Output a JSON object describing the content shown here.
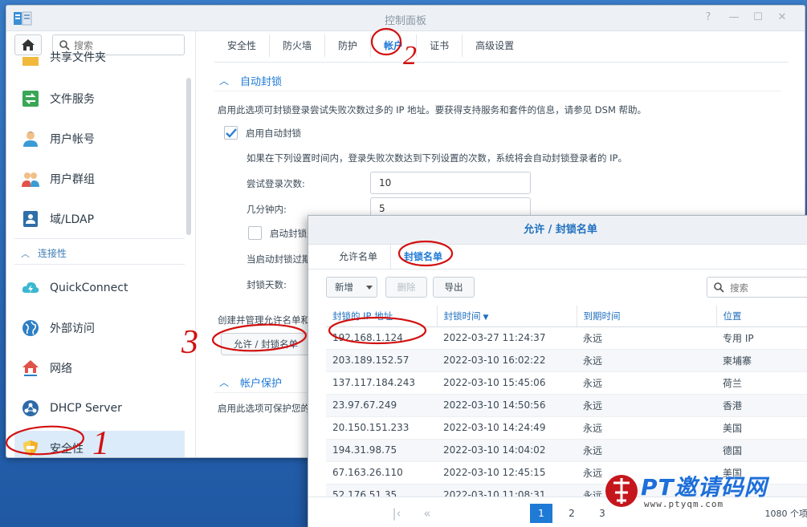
{
  "window": {
    "title": "控制面板"
  },
  "sidebar": {
    "search_placeholder": "搜索",
    "cut_item": "共享文件夹",
    "items": [
      {
        "label": "文件服务",
        "icon": "file-services-icon"
      },
      {
        "label": "用户帐号",
        "icon": "user-icon"
      },
      {
        "label": "用户群组",
        "icon": "group-icon"
      },
      {
        "label": "域/LDAP",
        "icon": "ldap-icon"
      }
    ],
    "section": "连接性",
    "conn_items": [
      {
        "label": "QuickConnect",
        "icon": "quickconnect-icon"
      },
      {
        "label": "外部访问",
        "icon": "external-access-icon"
      },
      {
        "label": "网络",
        "icon": "network-icon"
      },
      {
        "label": "DHCP Server",
        "icon": "dhcp-icon"
      },
      {
        "label": "安全性",
        "icon": "security-shield-icon"
      }
    ]
  },
  "tabs": [
    "安全性",
    "防火墙",
    "防护",
    "帐户",
    "证书",
    "高级设置"
  ],
  "autoblock": {
    "title": "自动封锁",
    "desc": "启用此选项可封锁登录尝试失败次数过多的 IP 地址。要获得支持服务和套件的信息，请参见 DSM 帮助。",
    "enable_label": "启用自动封锁",
    "hint": "如果在下列设置时间内，登录失败次数达到下列设置的次数，系统将会自动封锁登录者的 IP。",
    "attempts_label": "尝试登录次数:",
    "attempts_value": "10",
    "minutes_label": "几分钟内:",
    "minutes_value": "5",
    "expire_label": "启动封锁过",
    "expire_desc": "当启动封锁过期",
    "days_label": "封锁天数:",
    "manage_label": "创建并管理允许名单和",
    "allow_btn": "允许 / 封锁名单"
  },
  "account_protect": {
    "title": "帐户保护",
    "desc": "启用此选项可保护您的"
  },
  "dialog": {
    "title": "允许 / 封锁名单",
    "tabs": [
      "允许名单",
      "封锁名单"
    ],
    "btn_new": "新增",
    "btn_delete": "删除",
    "btn_export": "导出",
    "search_placeholder": "搜索",
    "columns": [
      "封锁的 IP 地址",
      "封锁时间",
      "到期时间",
      "位置"
    ],
    "rows": [
      [
        "192.168.1.124",
        "2022-03-27 11:24:37",
        "永远",
        "专用 IP"
      ],
      [
        "203.189.152.57",
        "2022-03-10 16:02:22",
        "永远",
        "柬埔寨"
      ],
      [
        "137.117.184.243",
        "2022-03-10 15:45:06",
        "永远",
        "荷兰"
      ],
      [
        "23.97.67.249",
        "2022-03-10 14:50:56",
        "永远",
        "香港"
      ],
      [
        "20.150.151.233",
        "2022-03-10 14:24:49",
        "永远",
        "美国"
      ],
      [
        "194.31.98.75",
        "2022-03-10 14:04:02",
        "永远",
        "德国"
      ],
      [
        "67.163.26.110",
        "2022-03-10 12:45:15",
        "永远",
        "美国"
      ],
      [
        "52.176.51.35",
        "2022-03-10 11:08:31",
        "永远",
        ""
      ]
    ],
    "pages": [
      "1",
      "2",
      "3"
    ],
    "current_page": "1",
    "total": "1080 个项"
  },
  "annotations": [
    "1",
    "2",
    "3"
  ],
  "watermark": {
    "text": "PT邀请码网",
    "url": "www.ptyqm.com"
  }
}
